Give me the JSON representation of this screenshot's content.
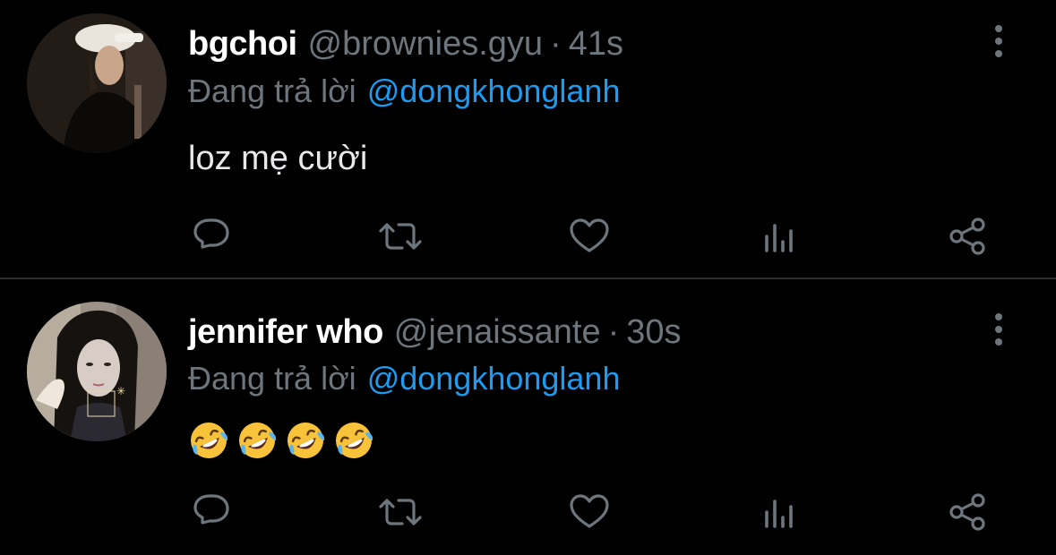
{
  "colors": {
    "background": "#000000",
    "text_primary": "#e7e9ea",
    "text_secondary": "#6e767d",
    "mention": "#1d9bf0",
    "divider": "#2a2f33"
  },
  "tweets": [
    {
      "display_name": "bgchoi",
      "handle": "@brownies.gyu",
      "separator": "·",
      "time": "41s",
      "reply_prefix": "Đang trả lời",
      "reply_to": "@dongkhonglanh",
      "text": "loz mẹ cười",
      "avatar_icon": "avatar-photo",
      "actions": [
        "reply-icon",
        "retweet-icon",
        "like-icon",
        "stats-icon",
        "share-icon"
      ]
    },
    {
      "display_name": "jennifer who",
      "handle": "@jenaissante",
      "separator": "·",
      "time": "30s",
      "reply_prefix": "Đang trả lời",
      "reply_to": "@dongkhonglanh",
      "text": "",
      "emojis": [
        "rolling-on-floor-laughing-emoji",
        "rolling-on-floor-laughing-emoji",
        "rolling-on-floor-laughing-emoji",
        "rolling-on-floor-laughing-emoji"
      ],
      "avatar_icon": "avatar-photo",
      "actions": [
        "reply-icon",
        "retweet-icon",
        "like-icon",
        "stats-icon",
        "share-icon"
      ]
    }
  ]
}
